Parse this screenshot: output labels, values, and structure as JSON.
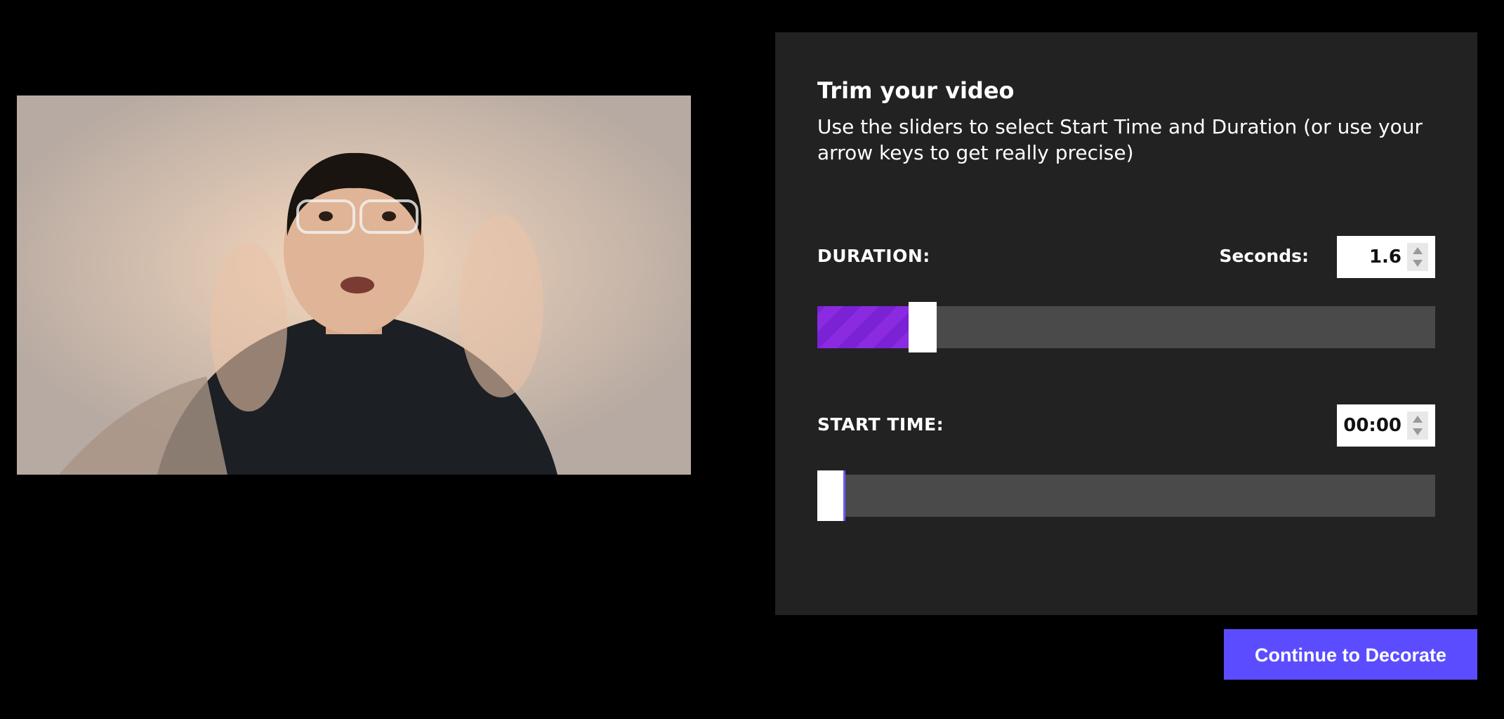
{
  "video": {
    "description_icon": "video-preview"
  },
  "panel": {
    "title": "Trim your video",
    "description": "Use the sliders to select Start Time and Duration (or use your arrow keys to get really precise)",
    "duration": {
      "label": "DURATION:",
      "seconds_label": "Seconds:",
      "value": "1.6",
      "slider_fraction": 0.1
    },
    "start_time": {
      "label": "START TIME:",
      "value": "00:00",
      "slider_fraction": 0.0
    }
  },
  "actions": {
    "continue_label": "Continue to Decorate"
  },
  "colors": {
    "accent": "#5b4dff",
    "slider_fill": "#8a2be2",
    "panel_bg": "#222222",
    "track_bg": "#4a4a4a"
  }
}
